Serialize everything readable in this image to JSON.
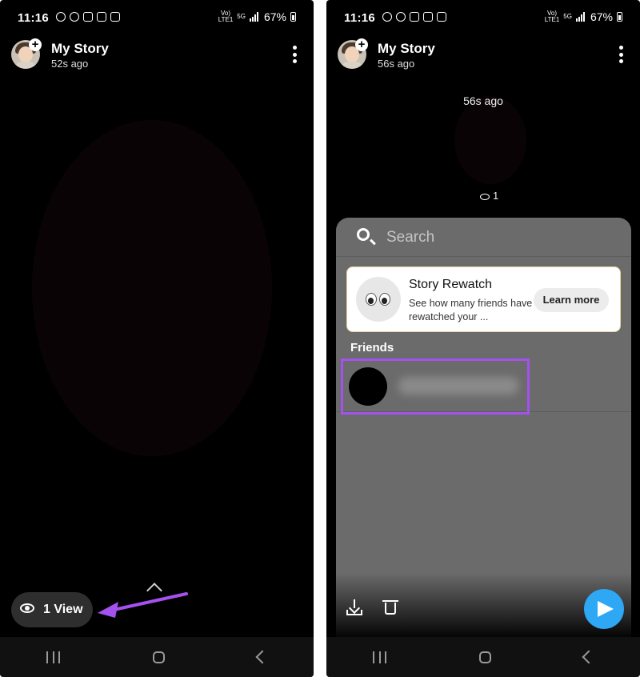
{
  "left_screen": {
    "status_bar": {
      "time": "11:16",
      "battery": "67%"
    },
    "header": {
      "title": "My Story",
      "subtitle": "52s ago"
    },
    "views_button": {
      "label": "1 View"
    }
  },
  "right_screen": {
    "status_bar": {
      "time": "11:16",
      "battery": "67%"
    },
    "header": {
      "title": "My Story",
      "subtitle": "56s ago"
    },
    "overlay": {
      "time_ago": "56s ago",
      "view_count": "1"
    },
    "sheet": {
      "search": {
        "placeholder": "Search"
      },
      "card": {
        "title": "Story Rewatch",
        "description": "See how many friends have rewatched your ...",
        "button_label": "Learn more"
      },
      "section_label": "Friends"
    }
  },
  "colors": {
    "highlight": "#a551ef",
    "send_button": "#2ea8f5",
    "sheet_bg": "#6b6b6b"
  },
  "icons": [
    "telegram-icon",
    "whatsapp-icon",
    "instagram-icon",
    "gmail-icon",
    "gallery-icon",
    "eye-icon",
    "search-icon",
    "download-icon",
    "trash-icon",
    "send-icon",
    "more-vertical-icon",
    "add-story-icon"
  ]
}
